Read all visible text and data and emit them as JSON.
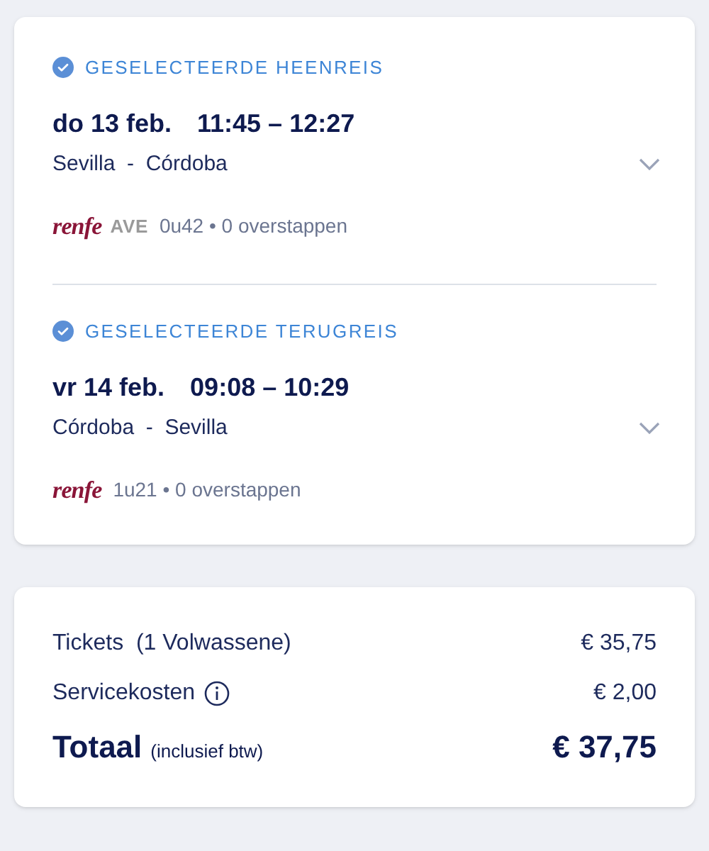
{
  "journeys": [
    {
      "label": "GESELECTEERDE HEENREIS",
      "date": "do 13 feb.",
      "times": "11:45 – 12:27",
      "route": "Sevilla  -  Córdoba",
      "carriers": [
        {
          "kind": "renfe",
          "name": "renfe"
        },
        {
          "kind": "ave",
          "name": "AVE"
        }
      ],
      "info": "0u42 • 0 overstappen"
    },
    {
      "label": "GESELECTEERDE TERUGREIS",
      "date": "vr 14 feb.",
      "times": "09:08 – 10:29",
      "route": "Córdoba  -  Sevilla",
      "carriers": [
        {
          "kind": "renfe",
          "name": "renfe"
        }
      ],
      "info": "1u21 • 0 overstappen"
    }
  ],
  "summary": {
    "lines": [
      {
        "kind": "plain",
        "label": "Tickets  (1 Volwassene)",
        "amount": "€ 35,75"
      },
      {
        "kind": "info",
        "label": "Servicekosten",
        "amount": "€ 2,00"
      }
    ],
    "total": {
      "label": "Totaal",
      "note": "(inclusief btw)",
      "amount": "€ 37,75"
    }
  }
}
